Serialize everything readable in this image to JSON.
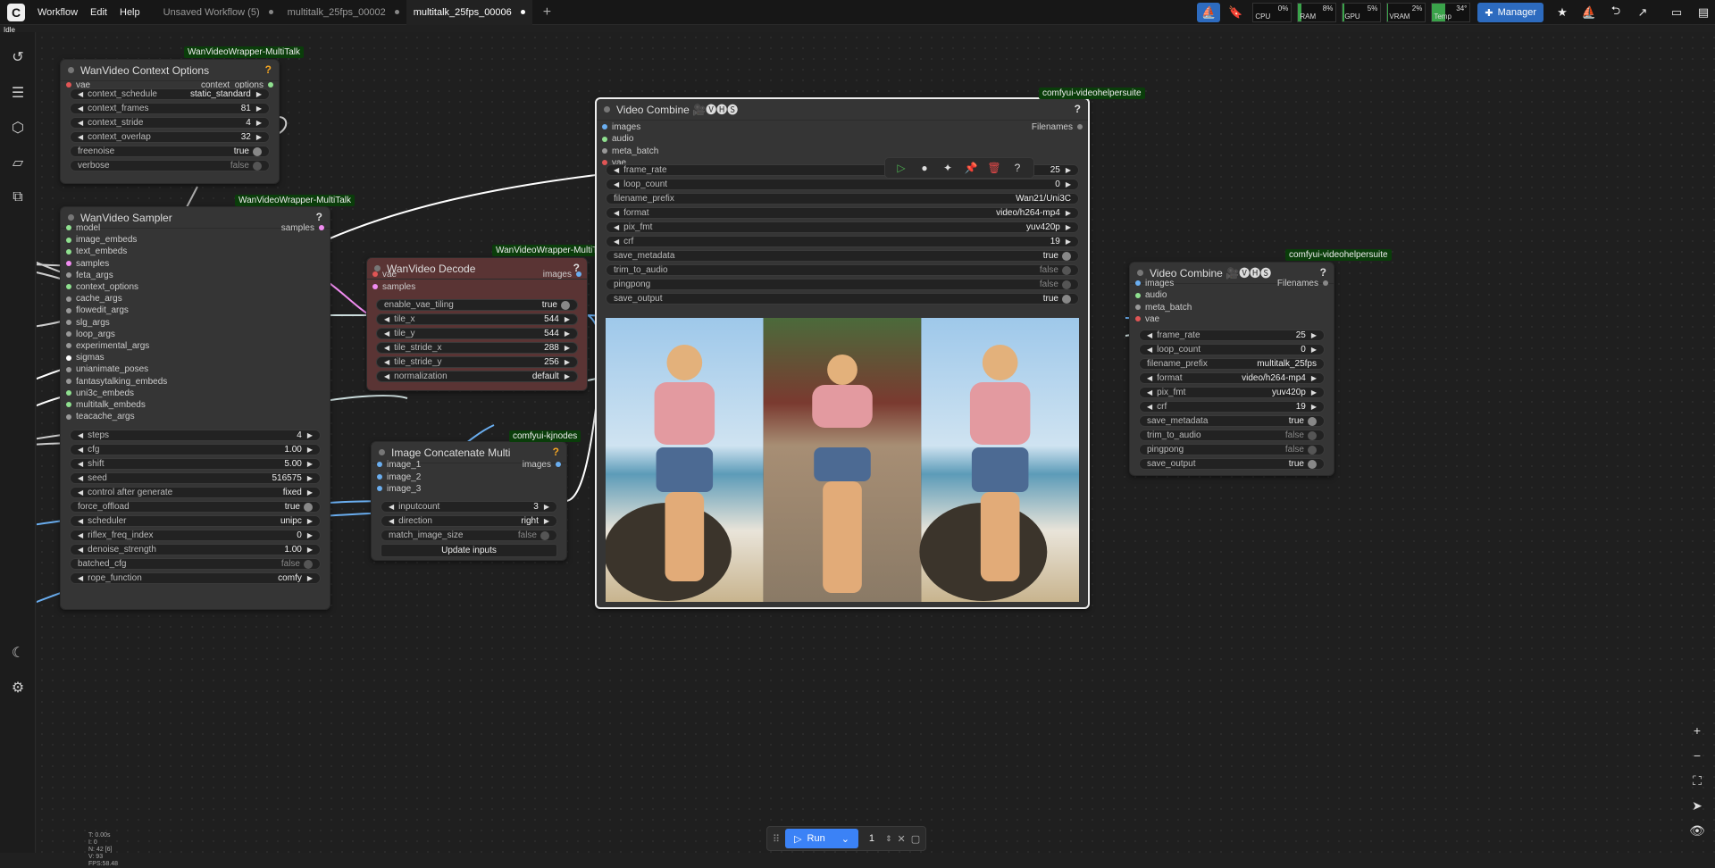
{
  "topbar": {
    "menus": [
      "Workflow",
      "Edit",
      "Help"
    ],
    "tabs": [
      {
        "label": "Unsaved Workflow (5)",
        "active": false
      },
      {
        "label": "multitalk_25fps_00002",
        "active": false
      },
      {
        "label": "multitalk_25fps_00006",
        "active": true
      }
    ],
    "meters": [
      {
        "label": "CPU",
        "value": "0%",
        "fill": 0
      },
      {
        "label": "RAM",
        "value": "8%",
        "fill": 8
      },
      {
        "label": "GPU",
        "value": "5%",
        "fill": 5
      },
      {
        "label": "VRAM",
        "value": "2%",
        "fill": 2
      },
      {
        "label": "Temp",
        "value": "34°",
        "fill": 34
      }
    ],
    "manager_label": "Manager"
  },
  "status": "Idle",
  "nodes": {
    "context_options": {
      "title": "WanVideo Context Options",
      "badge": "WanVideoWrapper-MultiTalk",
      "inputs": [
        "vae"
      ],
      "outputs": [
        "context_options"
      ],
      "widgets": [
        {
          "name": "context_schedule",
          "value": "static_standard"
        },
        {
          "name": "context_frames",
          "value": "81"
        },
        {
          "name": "context_stride",
          "value": "4"
        },
        {
          "name": "context_overlap",
          "value": "32"
        },
        {
          "name": "freenoise",
          "value": "true"
        },
        {
          "name": "verbose",
          "value": "false"
        }
      ]
    },
    "sampler": {
      "title": "WanVideo Sampler",
      "badge": "WanVideoWrapper-MultiTalk",
      "inputs": [
        "model",
        "image_embeds",
        "text_embeds",
        "samples",
        "feta_args",
        "context_options",
        "cache_args",
        "flowedit_args",
        "slg_args",
        "loop_args",
        "experimental_args",
        "sigmas",
        "unianimate_poses",
        "fantasytalking_embeds",
        "uni3c_embeds",
        "multitalk_embeds",
        "teacache_args"
      ],
      "outputs": [
        "samples"
      ],
      "widgets": [
        {
          "name": "steps",
          "value": "4"
        },
        {
          "name": "cfg",
          "value": "1.00"
        },
        {
          "name": "shift",
          "value": "5.00"
        },
        {
          "name": "seed",
          "value": "516575"
        },
        {
          "name": "control after generate",
          "value": "fixed"
        },
        {
          "name": "force_offload",
          "value": "true"
        },
        {
          "name": "scheduler",
          "value": "unipc"
        },
        {
          "name": "riflex_freq_index",
          "value": "0"
        },
        {
          "name": "denoise_strength",
          "value": "1.00"
        },
        {
          "name": "batched_cfg",
          "value": "false"
        },
        {
          "name": "rope_function",
          "value": "comfy"
        }
      ]
    },
    "decode": {
      "title": "WanVideo Decode",
      "badge": "WanVideoWrapper-MultiTalk",
      "inputs": [
        "vae",
        "samples"
      ],
      "outputs": [
        "images"
      ],
      "widgets": [
        {
          "name": "enable_vae_tiling",
          "value": "true"
        },
        {
          "name": "tile_x",
          "value": "544"
        },
        {
          "name": "tile_y",
          "value": "544"
        },
        {
          "name": "tile_stride_x",
          "value": "288"
        },
        {
          "name": "tile_stride_y",
          "value": "256"
        },
        {
          "name": "normalization",
          "value": "default"
        }
      ]
    },
    "concat": {
      "title": "Image Concatenate Multi",
      "badge": "comfyui-kjnodes",
      "inputs": [
        "image_1",
        "image_2",
        "image_3"
      ],
      "outputs": [
        "images"
      ],
      "widgets": [
        {
          "name": "inputcount",
          "value": "3"
        },
        {
          "name": "direction",
          "value": "right"
        },
        {
          "name": "match_image_size",
          "value": "false"
        }
      ],
      "button": "Update inputs"
    },
    "combine_main": {
      "title": "Video Combine 🎥🅥🅗🅢",
      "badge": "comfyui-videohelpersuite",
      "inputs": [
        "images",
        "audio",
        "meta_batch",
        "vae"
      ],
      "outputs": [
        "Filenames"
      ],
      "widgets": [
        {
          "name": "frame_rate",
          "value": "25"
        },
        {
          "name": "loop_count",
          "value": "0"
        },
        {
          "name": "filename_prefix",
          "value": "Wan21/Uni3C"
        },
        {
          "name": "format",
          "value": "video/h264-mp4"
        },
        {
          "name": "pix_fmt",
          "value": "yuv420p"
        },
        {
          "name": "crf",
          "value": "19"
        },
        {
          "name": "save_metadata",
          "value": "true"
        },
        {
          "name": "trim_to_audio",
          "value": "false"
        },
        {
          "name": "pingpong",
          "value": "false"
        },
        {
          "name": "save_output",
          "value": "true"
        }
      ]
    },
    "combine_side": {
      "title": "Video Combine 🎥🅥🅗🅢",
      "badge": "comfyui-videohelpersuite",
      "inputs": [
        "images",
        "audio",
        "meta_batch",
        "vae"
      ],
      "outputs": [
        "Filenames"
      ],
      "widgets": [
        {
          "name": "frame_rate",
          "value": "25"
        },
        {
          "name": "loop_count",
          "value": "0"
        },
        {
          "name": "filename_prefix",
          "value": "multitalk_25fps"
        },
        {
          "name": "format",
          "value": "video/h264-mp4"
        },
        {
          "name": "pix_fmt",
          "value": "yuv420p"
        },
        {
          "name": "crf",
          "value": "19"
        },
        {
          "name": "save_metadata",
          "value": "true"
        },
        {
          "name": "trim_to_audio",
          "value": "false"
        },
        {
          "name": "pingpong",
          "value": "false"
        },
        {
          "name": "save_output",
          "value": "true"
        }
      ]
    }
  },
  "runbar": {
    "run_label": "Run",
    "count": "1"
  },
  "stats": [
    "T: 0.00s",
    "I: 0",
    "N: 42 [6]",
    "V: 93",
    "FPS:58.48"
  ],
  "colors": {
    "accent": "#2d6bbf",
    "badge_bg": "#0a3d0a",
    "decode_bg": "#5a3434"
  }
}
